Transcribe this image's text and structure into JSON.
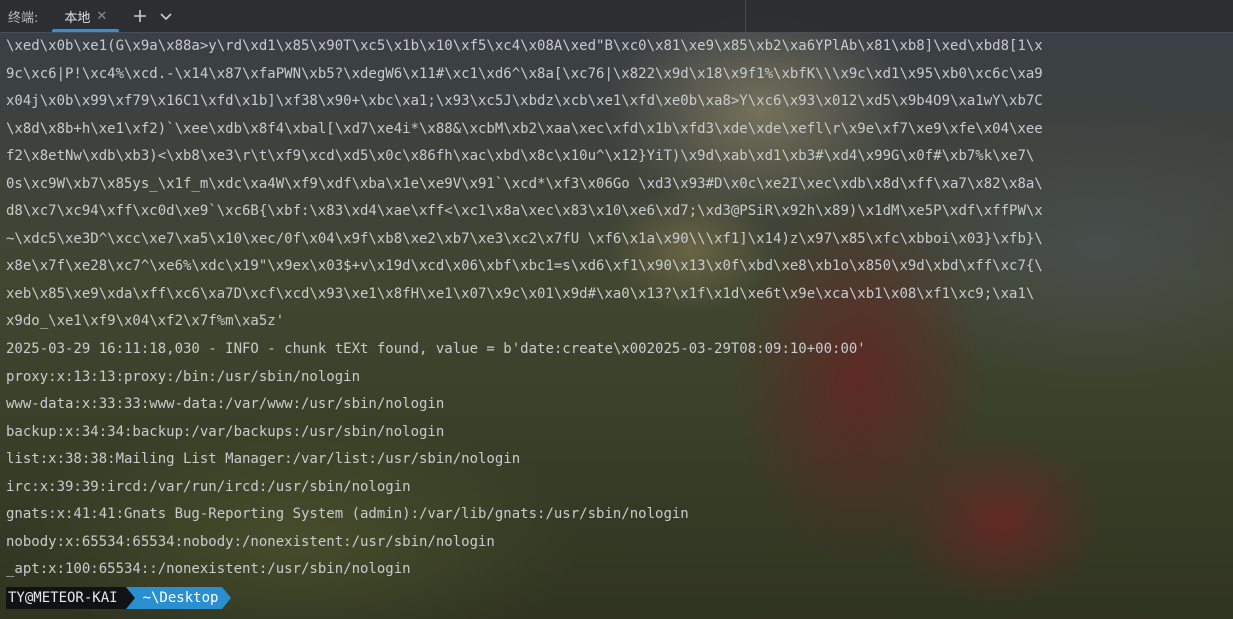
{
  "tabbar": {
    "title": "终端:",
    "tab_label": "本地",
    "tab_close": "✕",
    "add": "+",
    "chevron": "⌄"
  },
  "terminal": {
    "lines": [
      "\\xed\\x0b\\xe1(G\\x9a\\x88a>y\\rd\\xd1\\x85\\x90T\\xc5\\x1b\\x10\\xf5\\xc4\\x08A\\xed\"B\\xc0\\x81\\xe9\\x85\\xb2\\xa6YPlAb\\x81\\xb8]\\xed\\xbd8[1\\x",
      "9c\\xc6|P!\\xc4%\\xcd.-\\x14\\x87\\xfaPWN\\xb5?\\xdegW6\\x11#\\xc1\\xd6^\\x8a[\\xc76|\\x822\\x9d\\x18\\x9f1%\\xbfK\\\\\\x9c\\xd1\\x95\\xb0\\xc6c\\xa9",
      "x04j\\x0b\\x99\\xf79\\x16C1\\xfd\\x1b]\\xf38\\x90+\\xbc\\xa1;\\x93\\xc5J\\xbdz\\xcb\\xe1\\xfd\\xe0b\\xa8>Y\\xc6\\x93\\x012\\xd5\\x9b4O9\\xa1wY\\xb7C",
      "\\x8d\\x8b+h\\xe1\\xf2)`\\xee\\xdb\\x8f4\\xbal[\\xd7\\xe4i*\\x88&\\xcbM\\xb2\\xaa\\xec\\xfd\\x1b\\xfd3\\xde\\xde\\xefl\\r\\x9e\\xf7\\xe9\\xfe\\x04\\xee",
      "f2\\x8etNw\\xdb\\xb3)<\\xb8\\xe3\\r\\t\\xf9\\xcd\\xd5\\x0c\\x86fh\\xac\\xbd\\x8c\\x10u^\\x12}YiT)\\x9d\\xab\\xd1\\xb3#\\xd4\\x99G\\x0f#\\xb7%k\\xe7\\",
      "0s\\xc9W\\xb7\\x85ys_\\x1f_m\\xdc\\xa4W\\xf9\\xdf\\xba\\x1e\\xe9V\\x91`\\xcd*\\xf3\\x06Go \\xd3\\x93#D\\x0c\\xe2I\\xec\\xdb\\x8d\\xff\\xa7\\x82\\x8a\\",
      "d8\\xc7\\xc94\\xff\\xc0d\\xe9`\\xc6B{\\xbf:\\x83\\xd4\\xae\\xff<\\xc1\\x8a\\xec\\x83\\x10\\xe6\\xd7;\\xd3@PSiR\\x92h\\x89)\\x1dM\\xe5P\\xdf\\xffPW\\x",
      "~\\xdc5\\xe3D^\\xcc\\xe7\\xa5\\x10\\xec/0f\\x04\\x9f\\xb8\\xe2\\xb7\\xe3\\xc2\\x7fU \\xf6\\x1a\\x90\\\\\\xf1]\\x14)z\\x97\\x85\\xfc\\xbboi\\x03}\\xfb}\\",
      "x8e\\x7f\\xe28\\xc7^\\xe6%\\xdc\\x19\"\\x9ex\\x03$+v\\x19d\\xcd\\x06\\xbf\\xbc1=s\\xd6\\xf1\\x90\\x13\\x0f\\xbd\\xe8\\xb1o\\x850\\x9d\\xbd\\xff\\xc7{\\",
      "xeb\\x85\\xe9\\xda\\xff\\xc6\\xa7D\\xcf\\xcd\\x93\\xe1\\x8fH\\xe1\\x07\\x9c\\x01\\x9d#\\xa0\\x13?\\x1f\\x1d\\xe6t\\x9e\\xca\\xb1\\x08\\xf1\\xc9;\\xa1\\",
      "x9do_\\xe1\\xf9\\x04\\xf2\\x7f%m\\xa5z'",
      "2025-03-29 16:11:18,030 - INFO - chunk tEXt found, value = b'date:create\\x002025-03-29T08:09:10+00:00'",
      "proxy:x:13:13:proxy:/bin:/usr/sbin/nologin",
      "www-data:x:33:33:www-data:/var/www:/usr/sbin/nologin",
      "backup:x:34:34:backup:/var/backups:/usr/sbin/nologin",
      "list:x:38:38:Mailing List Manager:/var/list:/usr/sbin/nologin",
      "irc:x:39:39:ircd:/var/run/ircd:/usr/sbin/nologin",
      "gnats:x:41:41:Gnats Bug-Reporting System (admin):/var/lib/gnats:/usr/sbin/nologin",
      "nobody:x:65534:65534:nobody:/nonexistent:/usr/sbin/nologin",
      "_apt:x:100:65534::/nonexistent:/usr/sbin/nologin"
    ],
    "prompt": {
      "user": "TY@METEOR-KAI",
      "dir": "~\\Desktop"
    }
  }
}
